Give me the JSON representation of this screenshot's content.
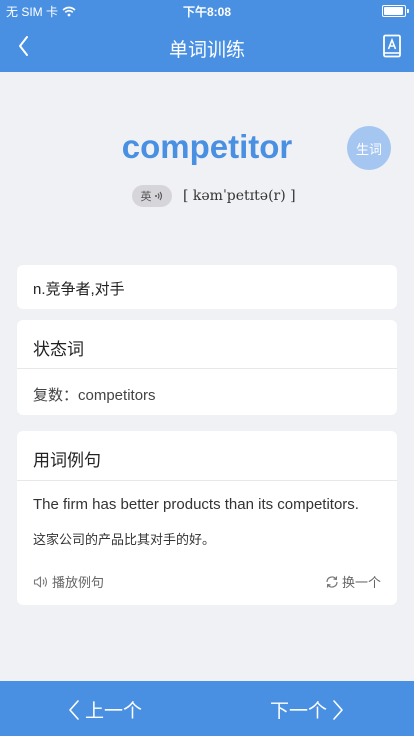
{
  "status_bar": {
    "carrier": "无 SIM 卡",
    "time": "下午8:08"
  },
  "nav": {
    "title": "单词训练",
    "back_icon": "chevron-left-icon",
    "book_icon": "address-book-icon"
  },
  "word": {
    "text": "competitor",
    "vocab_button": "生词",
    "accent_label": "英",
    "phonetic": "[ kəmˈpetɪtə(r) ]"
  },
  "definition": "n.竞争者,对手",
  "forms": {
    "title": "状态词",
    "plural": "复数：competitors"
  },
  "examples": {
    "title": "用词例句",
    "sentence_en": "The firm has better products than its competitors.",
    "sentence_zh": "这家公司的产品比其对手的好。",
    "play_label": "播放例句",
    "swap_label": "换一个"
  },
  "bottom": {
    "prev_label": "上一个",
    "next_label": "下一个"
  },
  "colors": {
    "primary": "#4a90e2",
    "background": "#f0f1f5",
    "vocab_button": "#a4c6f0"
  }
}
